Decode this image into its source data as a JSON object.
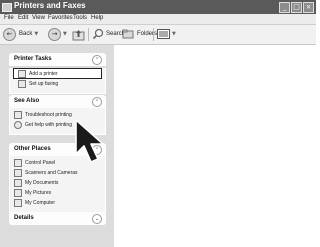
{
  "window": {
    "title": "Printers and Faxes"
  },
  "menu": [
    "File",
    "Edit",
    "View",
    "Favorites",
    "Tools",
    "Help"
  ],
  "toolbar": {
    "back_label": "Back",
    "search_label": "Search",
    "folders_label": "Folders"
  },
  "sidebar": {
    "printer_tasks": {
      "title": "Printer Tasks",
      "items": [
        "Add a printer",
        "Set up faxing"
      ]
    },
    "see_also": {
      "title": "See Also",
      "items": [
        "Troubleshoot printing",
        "Get help with printing"
      ]
    },
    "other_places": {
      "title": "Other Places",
      "items": [
        "Control Panel",
        "Scanners and Cameras",
        "My Documents",
        "My Pictures",
        "My Computer"
      ]
    },
    "details": {
      "title": "Details"
    }
  },
  "icons": {
    "back": "back-arrow-icon",
    "forward": "forward-arrow-icon",
    "up": "folder-up-icon",
    "search": "magnifier-icon",
    "folders": "folders-icon",
    "views": "views-icon",
    "collapse": "chevron-up-icon",
    "expand": "chevron-down-icon",
    "cursor": "mouse-pointer-icon"
  }
}
